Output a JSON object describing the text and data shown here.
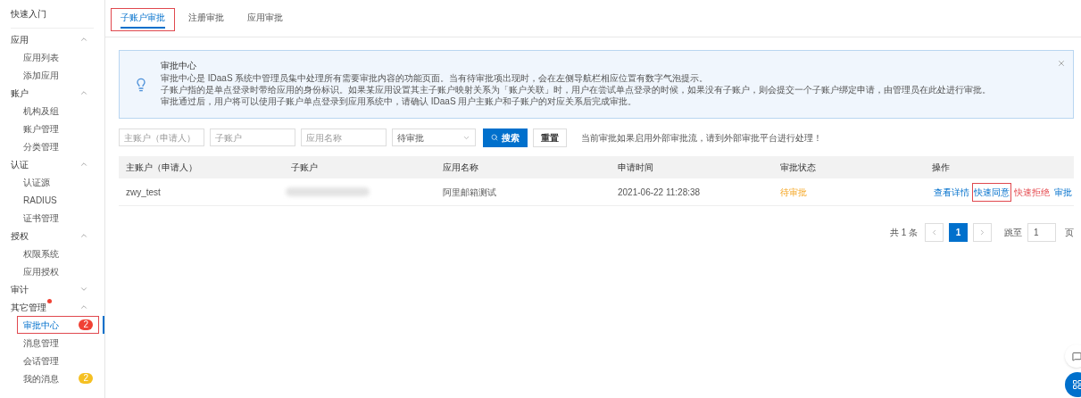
{
  "sidebar": {
    "items": [
      {
        "kind": "link",
        "label": "快速入门"
      },
      {
        "kind": "group",
        "label": "应用",
        "expanded": true,
        "dot": false,
        "children": [
          {
            "label": "应用列表",
            "selected": false,
            "highlighted": false
          },
          {
            "label": "添加应用",
            "selected": false,
            "highlighted": false
          }
        ]
      },
      {
        "kind": "group",
        "label": "账户",
        "expanded": true,
        "dot": false,
        "children": [
          {
            "label": "机构及组",
            "selected": false,
            "highlighted": false
          },
          {
            "label": "账户管理",
            "selected": false,
            "highlighted": false
          },
          {
            "label": "分类管理",
            "selected": false,
            "highlighted": false
          }
        ]
      },
      {
        "kind": "group",
        "label": "认证",
        "expanded": true,
        "dot": false,
        "children": [
          {
            "label": "认证源",
            "selected": false,
            "highlighted": false
          },
          {
            "label": "RADIUS",
            "selected": false,
            "highlighted": false
          },
          {
            "label": "证书管理",
            "selected": false,
            "highlighted": false
          }
        ]
      },
      {
        "kind": "group",
        "label": "授权",
        "expanded": true,
        "dot": false,
        "children": [
          {
            "label": "权限系统",
            "selected": false,
            "highlighted": false
          },
          {
            "label": "应用授权",
            "selected": false,
            "highlighted": false
          }
        ]
      },
      {
        "kind": "group",
        "label": "审计",
        "expanded": false,
        "dot": false
      },
      {
        "kind": "group",
        "label": "其它管理",
        "expanded": true,
        "dot": true,
        "children": [
          {
            "label": "审批中心",
            "selected": true,
            "highlighted": true,
            "badge": "2",
            "color": "#f04134"
          },
          {
            "label": "消息管理",
            "selected": false,
            "highlighted": false
          },
          {
            "label": "会话管理",
            "selected": false,
            "highlighted": false
          },
          {
            "label": "我的消息",
            "selected": false,
            "highlighted": false,
            "badge": "2",
            "color": "#f5c022"
          }
        ]
      }
    ]
  },
  "tabs": [
    {
      "label": "子账户审批",
      "selected": true,
      "highlighted": true
    },
    {
      "label": "注册审批",
      "selected": false,
      "highlighted": false
    },
    {
      "label": "应用审批",
      "selected": false,
      "highlighted": false
    }
  ],
  "notice": {
    "title": "审批中心",
    "lines": [
      "审批中心是 IDaaS 系统中管理员集中处理所有需要审批内容的功能页面。当有待审批项出现时，会在左侧导航栏相应位置有数字气泡提示。",
      "子账户指的是单点登录时带给应用的身份标识。如果某应用设置其主子账户映射关系为「账户关联」时，用户在尝试单点登录的时候，如果没有子账户，则会提交一个子账户绑定申请，由管理员在此处进行审批。",
      "审批通过后，用户将可以使用子账户单点登录到应用系统中，请确认 IDaaS 用户主账户和子账户的对应关系后完成审批。"
    ]
  },
  "filters": {
    "fields": [
      {
        "placeholder": "主账户（申请人）"
      },
      {
        "placeholder": "子账户"
      },
      {
        "placeholder": "应用名称"
      }
    ],
    "status_select": "待审批",
    "search_button": "搜索",
    "reset_button": "重置",
    "hint": "当前审批如果启用外部审批流，请到外部审批平台进行处理！"
  },
  "table": {
    "columns": [
      "主账户（申请人）",
      "子账户",
      "应用名称",
      "申请时间",
      "审批状态",
      "操作"
    ],
    "rows": [
      {
        "main_account": "zwy_test",
        "sub_account_redacted": true,
        "app": "阿里邮箱测试",
        "time": "2021-06-22 11:28:38",
        "status": "待审批",
        "actions": [
          {
            "label": "查看详情",
            "kind": "normal",
            "highlighted": false
          },
          {
            "label": "快速同意",
            "kind": "normal",
            "highlighted": true
          },
          {
            "label": "快速拒绝",
            "kind": "danger",
            "highlighted": false
          },
          {
            "label": "审批",
            "kind": "normal",
            "highlighted": false
          }
        ]
      }
    ]
  },
  "pagination": {
    "total": "共 1 条",
    "pages": [
      {
        "label": "1",
        "selected": true
      }
    ],
    "jump_label": "跳至",
    "jump_value": "1",
    "page_unit": "页"
  }
}
